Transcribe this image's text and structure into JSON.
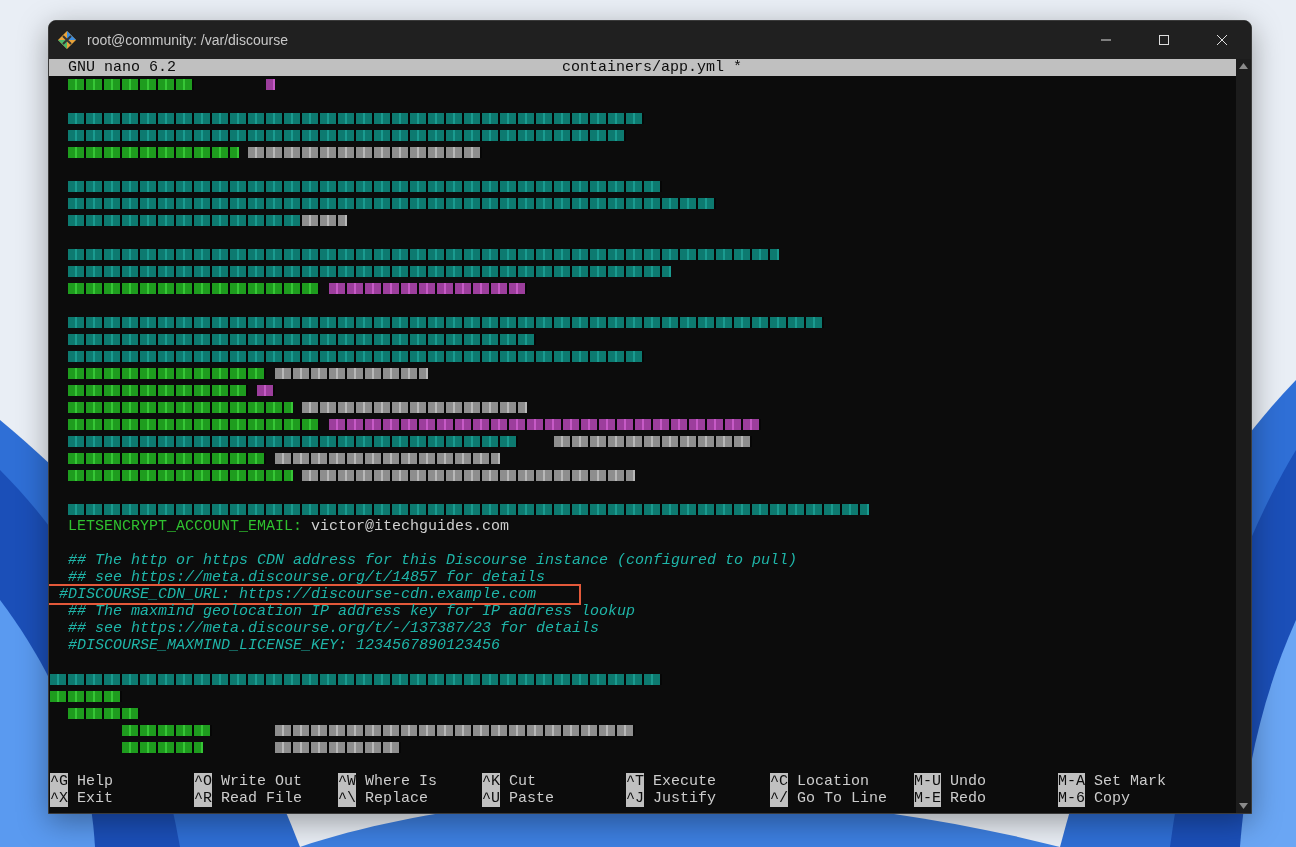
{
  "window": {
    "title": "root@community: /var/discourse"
  },
  "editor": {
    "app": "GNU nano 6.2",
    "file": "containers/app.yml *"
  },
  "lines": [
    {
      "kind": "blurred"
    },
    {
      "kind": "blank"
    },
    {
      "kind": "blurred"
    },
    {
      "kind": "blurred"
    },
    {
      "kind": "blurred"
    },
    {
      "kind": "blank"
    },
    {
      "kind": "blurred"
    },
    {
      "kind": "blurred"
    },
    {
      "kind": "blurred"
    },
    {
      "kind": "blank"
    },
    {
      "kind": "blurred"
    },
    {
      "kind": "blurred"
    },
    {
      "kind": "blurred"
    },
    {
      "kind": "blank"
    },
    {
      "kind": "blurred"
    },
    {
      "kind": "blurred"
    },
    {
      "kind": "blurred"
    },
    {
      "kind": "blurred"
    },
    {
      "kind": "blurred"
    },
    {
      "kind": "blurred"
    },
    {
      "kind": "blurred"
    },
    {
      "kind": "blurred"
    },
    {
      "kind": "blurred"
    },
    {
      "kind": "blurred"
    },
    {
      "kind": "blank"
    },
    {
      "kind": "blurred"
    },
    {
      "kind": "setting",
      "key": "  LETSENCRYPT_ACCOUNT_EMAIL:",
      "value": "victor@itechguides.com"
    },
    {
      "kind": "blank"
    },
    {
      "kind": "comment",
      "text": "  ## The http or https CDN address for this Discourse instance (configured to pull)",
      "highlighted": false
    },
    {
      "kind": "comment",
      "text": "  ## see https://meta.discourse.org/t/14857 for details",
      "highlighted": false
    },
    {
      "kind": "comment",
      "text": " #DISCOURSE_CDN_URL: https://discourse-cdn.example.com",
      "highlighted": true
    },
    {
      "kind": "comment",
      "text": "  ## The maxmind geolocation IP address key for IP address lookup",
      "highlighted": false
    },
    {
      "kind": "comment",
      "text": "  ## see https://meta.discourse.org/t/-/137387/23 for details",
      "highlighted": false
    },
    {
      "kind": "comment",
      "text": "  #DISCOURSE_MAXMIND_LICENSE_KEY: 1234567890123456",
      "highlighted": false
    },
    {
      "kind": "blank"
    },
    {
      "kind": "blurred"
    },
    {
      "kind": "blurred"
    },
    {
      "kind": "blurred"
    },
    {
      "kind": "blurred"
    },
    {
      "kind": "blurred"
    }
  ],
  "shortcuts": [
    [
      {
        "key": "^G",
        "label": "Help"
      },
      {
        "key": "^O",
        "label": "Write Out"
      },
      {
        "key": "^W",
        "label": "Where Is"
      },
      {
        "key": "^K",
        "label": "Cut"
      },
      {
        "key": "^T",
        "label": "Execute"
      },
      {
        "key": "^C",
        "label": "Location"
      },
      {
        "key": "M-U",
        "label": "Undo"
      },
      {
        "key": "M-A",
        "label": "Set Mark"
      }
    ],
    [
      {
        "key": "^X",
        "label": "Exit"
      },
      {
        "key": "^R",
        "label": "Read File"
      },
      {
        "key": "^\\",
        "label": "Replace"
      },
      {
        "key": "^U",
        "label": "Paste"
      },
      {
        "key": "^J",
        "label": "Justify"
      },
      {
        "key": "^/",
        "label": "Go To Line"
      },
      {
        "key": "M-E",
        "label": "Redo"
      },
      {
        "key": "M-6",
        "label": "Copy"
      }
    ]
  ]
}
